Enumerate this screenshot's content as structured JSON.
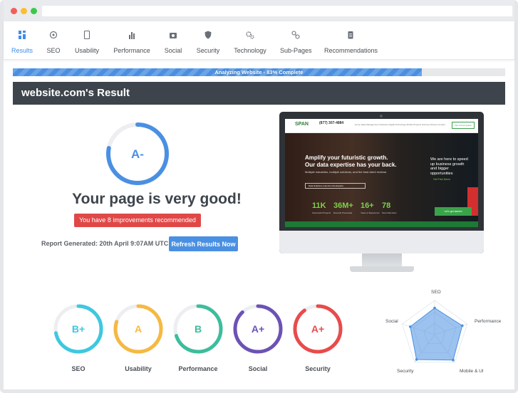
{
  "nav": {
    "items": [
      {
        "label": "Results",
        "icon": "grid-icon",
        "active": true
      },
      {
        "label": "SEO",
        "icon": "target-icon",
        "active": false
      },
      {
        "label": "Usability",
        "icon": "tablet-icon",
        "active": false
      },
      {
        "label": "Performance",
        "icon": "bar-chart-icon",
        "active": false
      },
      {
        "label": "Social",
        "icon": "camera-icon",
        "active": false
      },
      {
        "label": "Security",
        "icon": "shield-icon",
        "active": false
      },
      {
        "label": "Technology",
        "icon": "gears-icon",
        "active": false
      },
      {
        "label": "Sub-Pages",
        "icon": "link-icon",
        "active": false
      },
      {
        "label": "Recommendations",
        "icon": "clipboard-icon",
        "active": false
      }
    ]
  },
  "progress": {
    "label": "Analyzing Website - 83% Complete",
    "percent": 83
  },
  "panel": {
    "title": "website.com's Result"
  },
  "result": {
    "overall_grade": "A-",
    "overall_fraction": 0.78,
    "headline": "Your page is very good!",
    "improvements_badge": "You have 8 improvements recommended",
    "report_generated": "Report Generated: 20th April 9:07AM UTC",
    "refresh_button": "Refresh Results Now"
  },
  "grades": [
    {
      "label": "SEO",
      "grade": "B+",
      "color": "#3ec8e0",
      "fraction": 0.72
    },
    {
      "label": "Usability",
      "grade": "A",
      "color": "#f5b942",
      "fraction": 0.8
    },
    {
      "label": "Performance",
      "grade": "B",
      "color": "#3dbd9c",
      "fraction": 0.7
    },
    {
      "label": "Social",
      "grade": "A+",
      "color": "#6c52b5",
      "fraction": 0.88
    },
    {
      "label": "Security",
      "grade": "A+",
      "color": "#e94b4b",
      "fraction": 0.9
    }
  ],
  "radar": {
    "labels": [
      "SEO",
      "Performance",
      "Mobile & UI",
      "Security",
      "Social"
    ],
    "values": [
      0.78,
      0.85,
      0.92,
      0.9,
      0.75
    ],
    "color": "#4a90e2"
  },
  "preview": {
    "logo": "SPAN",
    "phone": "(877) 307-4884",
    "links": "Home  Data Management Solutions  Digital Technology  Mobile Projects  Success Stories  Contact",
    "cta": "Get a Free Quote",
    "hero_title": "Amplify your futuristic growth. Our data expertise has your back.",
    "hero_sub": "Multiple industries, multiple solutions, and the best client reviews",
    "hero_pill": "Data Solutions only from the Experts",
    "stats": [
      "11K",
      "36M+",
      "16+",
      "78"
    ],
    "stat_subs": [
      "Successful Projects",
      "Records Processed",
      "Years of Experience",
      "Team Members"
    ],
    "right_text": "We are here to speed up business growth and bigger opportunities",
    "right_link": "Get Free Demo",
    "green_tab": "Let's get started"
  },
  "colors": {
    "accent": "#4a90e2",
    "dark": "#3d444c",
    "danger": "#e04848"
  }
}
